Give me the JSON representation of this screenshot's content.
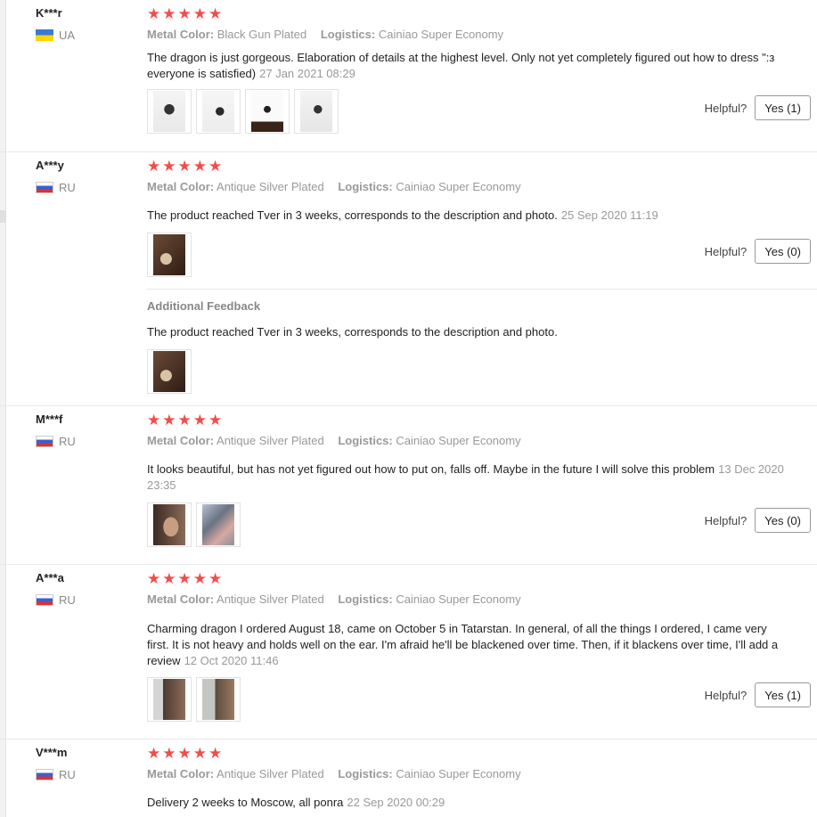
{
  "reviews": [
    {
      "user": "K***r",
      "country": "UA",
      "flag": "ua",
      "metal_label": "Metal Color:",
      "metal": "Black Gun Plated",
      "logistics_label": "Logistics:",
      "logistics": "Cainiao Super Economy",
      "text": "The dragon is just gorgeous. Elaboration of details at the highest level. Only not yet completely figured out how to dress \":з everyone is satisfied)",
      "date": "27 Jan 2021 08:29",
      "photos": [
        "drag1",
        "drag2",
        "drag3",
        "drag4"
      ],
      "helpful_label": "Helpful?",
      "yes_label": "Yes (1)"
    },
    {
      "user": "A***y",
      "country": "RU",
      "flag": "ru",
      "metal_label": "Metal Color:",
      "metal": "Antique Silver Plated",
      "logistics_label": "Logistics:",
      "logistics": "Cainiao Super Economy",
      "text": "The product reached Tver in 3 weeks, corresponds to the description and photo.",
      "date": "25 Sep 2020 11:19",
      "photos": [
        "photo-brown"
      ],
      "helpful_label": "Helpful?",
      "yes_label": "Yes (0)",
      "additional": {
        "title": "Additional Feedback",
        "text": "The product reached Tver in 3 weeks, corresponds to the description and photo.",
        "photos": [
          "photo-brown"
        ]
      }
    },
    {
      "user": "M***f",
      "country": "RU",
      "flag": "ru",
      "metal_label": "Metal Color:",
      "metal": "Antique Silver Plated",
      "logistics_label": "Logistics:",
      "logistics": "Cainiao Super Economy",
      "text": "It looks beautiful, but has not yet figured out how to put on, falls off. Maybe in the future I will solve this problem",
      "date": "13 Dec 2020 23:35",
      "photos": [
        "ear",
        "shine"
      ],
      "helpful_label": "Helpful?",
      "yes_label": "Yes (0)"
    },
    {
      "user": "A***a",
      "country": "RU",
      "flag": "ru",
      "metal_label": "Metal Color:",
      "metal": "Antique Silver Plated",
      "logistics_label": "Logistics:",
      "logistics": "Cainiao Super Economy",
      "text": "Charming dragon I ordered August 18, came on October 5 in Tatarstan. In general, of all the things I ordered, I came very first. It is not heavy and holds well on the ear. I'm afraid he'll be blackened over time. Then, if it blackens over time, I'll add a review",
      "date": "12 Oct 2020 11:46",
      "photos": [
        "ear2",
        "ear3"
      ],
      "helpful_label": "Helpful?",
      "yes_label": "Yes (1)"
    },
    {
      "user": "V***m",
      "country": "RU",
      "flag": "ru",
      "metal_label": "Metal Color:",
      "metal": "Antique Silver Plated",
      "logistics_label": "Logistics:",
      "logistics": "Cainiao Super Economy",
      "text": "Delivery 2 weeks to Moscow, all ponra",
      "date": "22 Sep 2020 00:29",
      "photos": [],
      "helpful_label": "",
      "yes_label": ""
    }
  ],
  "rating_stars": 5,
  "star_color": "#f34c4c"
}
